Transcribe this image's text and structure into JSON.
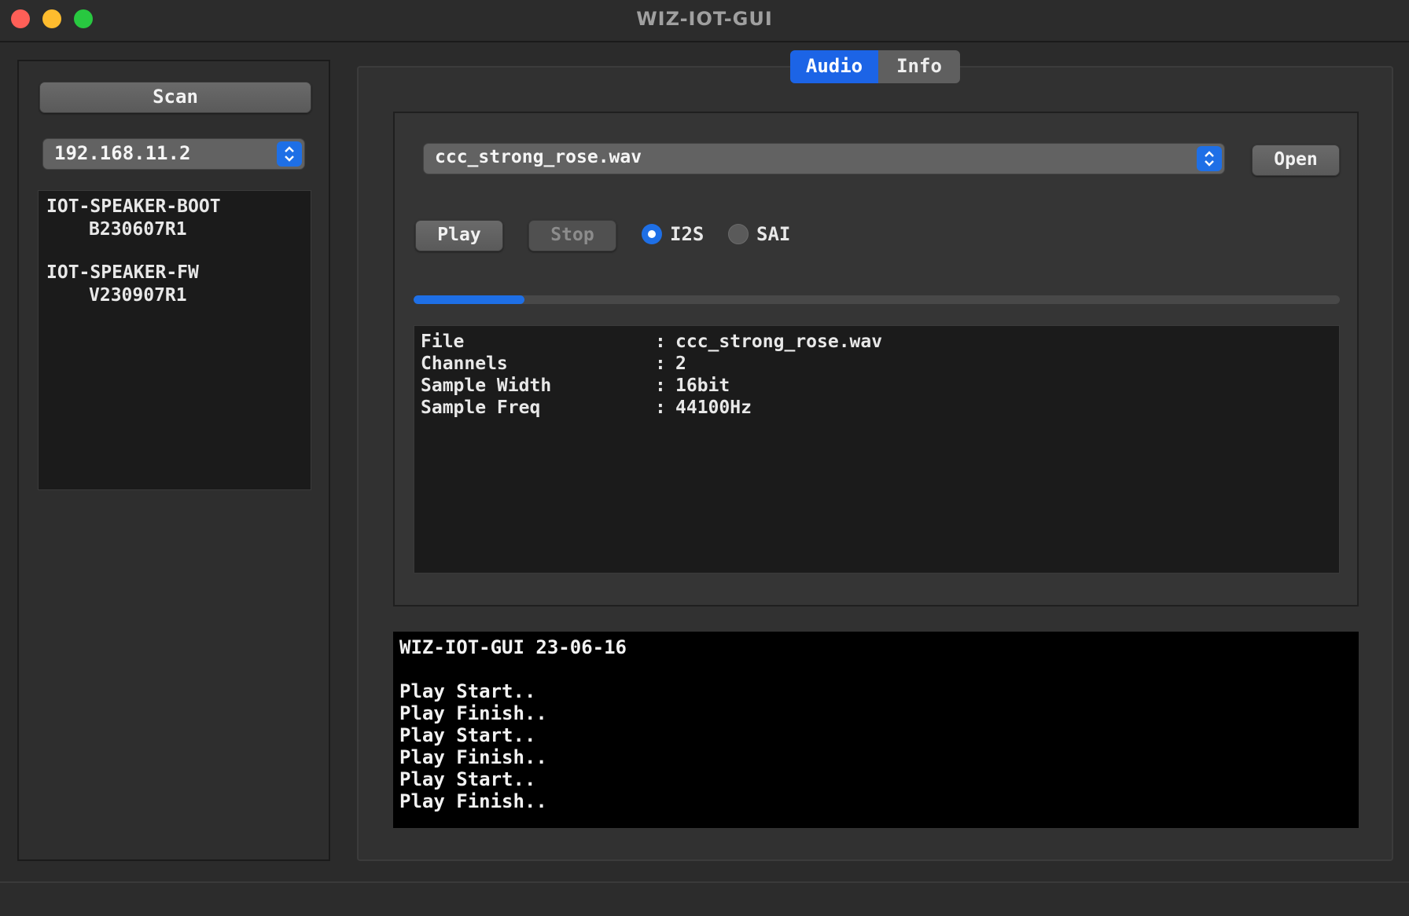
{
  "window": {
    "title": "WIZ-IOT-GUI"
  },
  "left": {
    "scan_label": "Scan",
    "ip_value": "192.168.11.2",
    "devices": [
      {
        "name": "IOT-SPEAKER-BOOT",
        "version": "B230607R1"
      },
      {
        "name": "IOT-SPEAKER-FW",
        "version": "V230907R1"
      }
    ]
  },
  "tabs": [
    {
      "label": "Audio",
      "active": true
    },
    {
      "label": "Info",
      "active": false
    }
  ],
  "audio": {
    "file_value": "ccc_strong_rose.wav",
    "open_label": "Open",
    "play_label": "Play",
    "stop_label": "Stop",
    "radio_i2s": "I2S",
    "radio_sai": "SAI",
    "selected_interface": "I2S",
    "progress": 0.12,
    "info": [
      {
        "key": "File",
        "value": "ccc_strong_rose.wav"
      },
      {
        "key": "Channels",
        "value": "2"
      },
      {
        "key": "Sample Width",
        "value": "16bit"
      },
      {
        "key": "Sample Freq",
        "value": "44100Hz"
      }
    ],
    "sep": ":"
  },
  "log": {
    "header": "WIZ-IOT-GUI 23-06-16",
    "lines": [
      "Play Start..",
      "Play Finish..",
      "Play Start..",
      "Play Finish..",
      "Play Start..",
      "Play Finish.."
    ]
  },
  "colors": {
    "accent": "#1e6fe6",
    "close": "#ff5f57",
    "minimize": "#febc2e",
    "maximize": "#28c840"
  },
  "icons": {
    "combo_arrow": "up-down-chevron-icon"
  }
}
